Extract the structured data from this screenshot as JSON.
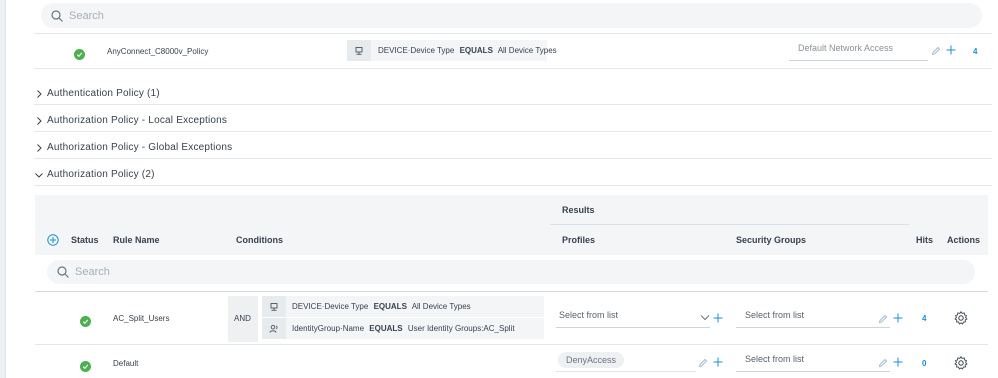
{
  "top_search": {
    "placeholder": "Search"
  },
  "authn_row": {
    "policy_name": "AnyConnect_C8000v_Policy",
    "condition": {
      "attribute": "DEVICE·Device Type",
      "operator": "EQUALS",
      "value": "All Device Types"
    },
    "result": "Default Network Access",
    "hits": "4"
  },
  "sections": [
    {
      "label": "Authentication Policy (1)",
      "expanded": false
    },
    {
      "label": "Authorization Policy - Local Exceptions",
      "expanded": false
    },
    {
      "label": "Authorization Policy - Global Exceptions",
      "expanded": false
    },
    {
      "label": "Authorization Policy (2)",
      "expanded": true
    }
  ],
  "authz_table": {
    "group_header": "Results",
    "columns": {
      "status": "Status",
      "rule_name": "Rule Name",
      "conditions": "Conditions",
      "profiles": "Profiles",
      "security_groups": "Security Groups",
      "hits": "Hits",
      "actions": "Actions"
    },
    "search_placeholder": "Search",
    "rows": [
      {
        "rule_name": "AC_Split_Users",
        "operator": "AND",
        "conditions": [
          {
            "attribute": "DEVICE·Device Type",
            "operator": "EQUALS",
            "value": "All Device Types",
            "icon": "device-icon"
          },
          {
            "attribute": "IdentityGroup·Name",
            "operator": "EQUALS",
            "value": "User Identity Groups:AC_Split",
            "icon": "user-group-icon"
          }
        ],
        "profiles": "Select from list",
        "security_groups": "Select from list",
        "hits": "4"
      },
      {
        "rule_name": "Default",
        "profiles": "DenyAccess",
        "security_groups": "Select from list",
        "hits": "0"
      }
    ]
  },
  "colors": {
    "status_green": "#4caf50",
    "accent_blue": "#1b8fd6",
    "header_bg": "#f4f5f7"
  }
}
